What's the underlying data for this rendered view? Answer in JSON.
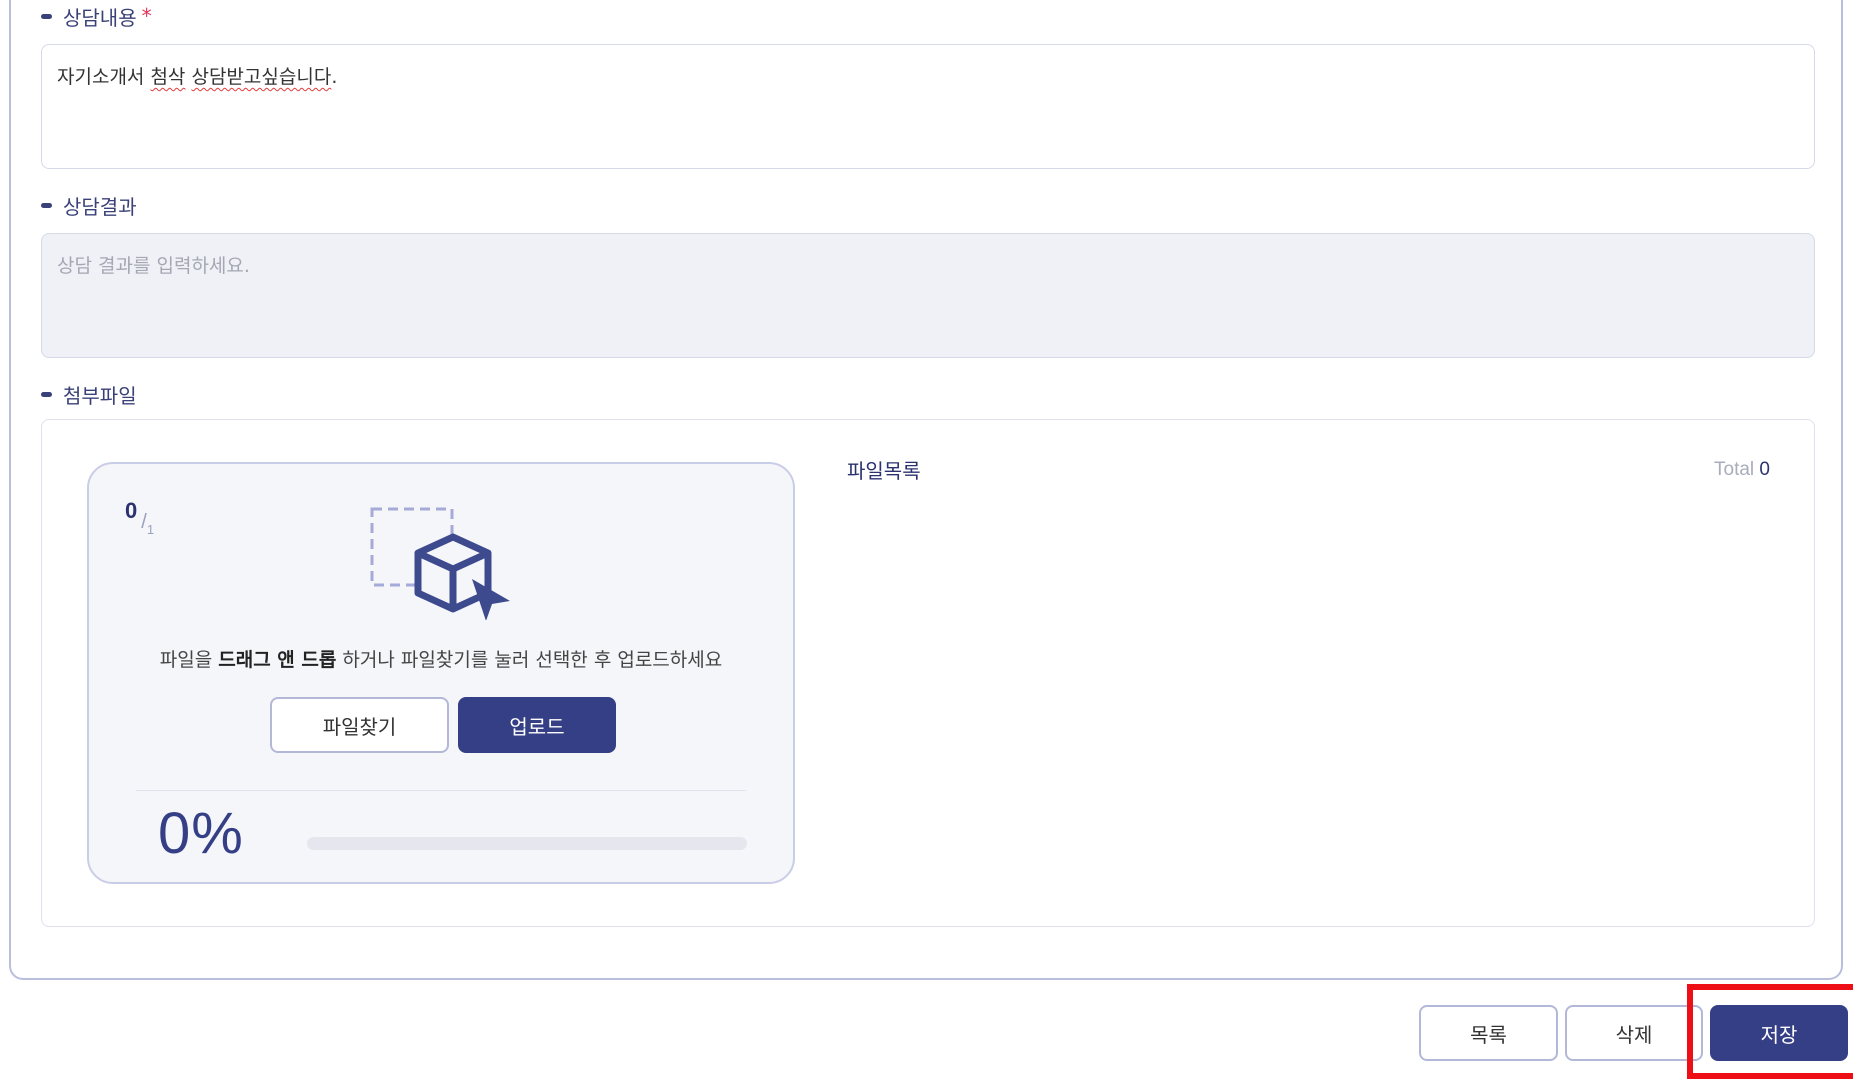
{
  "form": {
    "consult_content": {
      "label": "상담내용",
      "required_mark": "*",
      "value_plain_1": "자기소개서 ",
      "value_err_1": "첨삭",
      "value_plain_2": " ",
      "value_err_2": "상담받고싶습니다",
      "value_plain_3": "."
    },
    "consult_result": {
      "label": "상담결과",
      "placeholder": "상담 결과를 입력하세요."
    },
    "attachments": {
      "label": "첨부파일"
    }
  },
  "uploader": {
    "count_current": "0",
    "count_slash": "/",
    "count_max": "1",
    "hint_prefix": "파일을 ",
    "hint_bold": "드래그 앤 드롭",
    "hint_suffix": " 하거나 파일찾기를 눌러 선택한 후 업로드하세요",
    "find_button": "파일찾기",
    "upload_button": "업로드",
    "progress_percent": 0,
    "progress_label": "0%"
  },
  "file_list": {
    "title": "파일목록",
    "total_label": "Total",
    "total_count": "0"
  },
  "footer": {
    "list_button": "목록",
    "delete_button": "삭제",
    "save_button": "저장"
  },
  "colors": {
    "primary": "#353f85",
    "required": "#e0335a",
    "highlight": "#ee0f16"
  }
}
